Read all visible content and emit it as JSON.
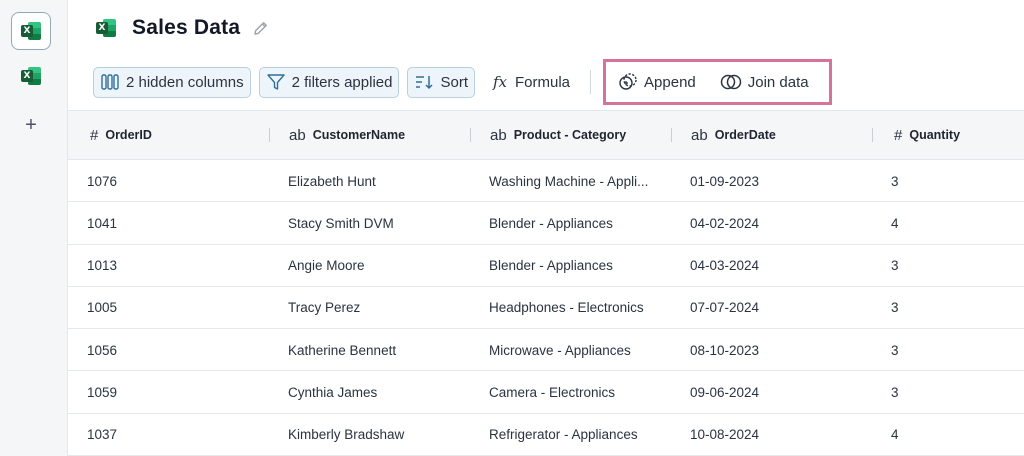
{
  "sidebar": {
    "add_label": "+"
  },
  "header": {
    "title": "Sales Data"
  },
  "toolbar": {
    "hidden_columns": "2 hidden columns",
    "filters": "2 filters applied",
    "sort": "Sort",
    "formula": "Formula",
    "formula_icon": "fx",
    "append": "Append",
    "join": "Join data"
  },
  "table": {
    "columns": [
      {
        "type": "#",
        "name": "OrderID"
      },
      {
        "type": "ab",
        "name": "CustomerName"
      },
      {
        "type": "ab",
        "name": "Product - Category"
      },
      {
        "type": "ab",
        "name": "OrderDate"
      },
      {
        "type": "#",
        "name": "Quantity"
      }
    ],
    "rows": [
      [
        "1076",
        "Elizabeth Hunt",
        "Washing Machine - Appli...",
        "01-09-2023",
        "3"
      ],
      [
        "1041",
        "Stacy Smith DVM",
        "Blender - Appliances",
        "04-02-2024",
        "4"
      ],
      [
        "1013",
        "Angie Moore",
        "Blender - Appliances",
        "04-03-2024",
        "3"
      ],
      [
        "1005",
        "Tracy Perez",
        "Headphones - Electronics",
        "07-07-2024",
        "3"
      ],
      [
        "1056",
        "Katherine Bennett",
        "Microwave - Appliances",
        "08-10-2023",
        "3"
      ],
      [
        "1059",
        "Cynthia James",
        "Camera - Electronics",
        "09-06-2024",
        "3"
      ],
      [
        "1037",
        "Kimberly Bradshaw",
        "Refrigerator - Appliances",
        "10-08-2024",
        "4"
      ]
    ]
  },
  "colors": {
    "accent_highlight": "#d5739b",
    "button_bg": "#eef5fa",
    "button_border": "#b9cfdc"
  }
}
